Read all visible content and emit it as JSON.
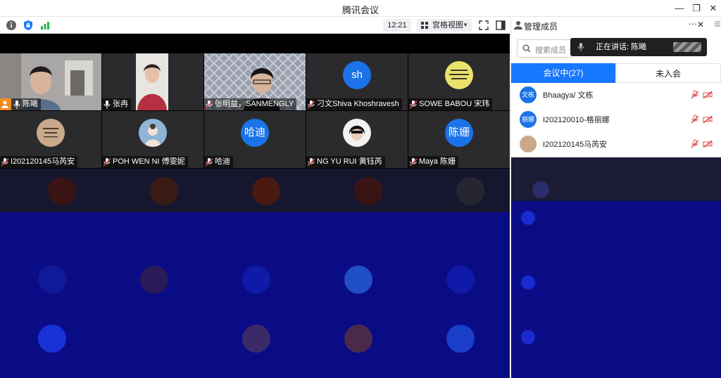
{
  "window": {
    "title": "腾讯会议",
    "minimize_icon": "minimize-icon",
    "restore_icon": "restore-icon",
    "close_icon": "close-icon"
  },
  "toolbar": {
    "info_icon": "info-icon",
    "shield_icon": "shield-icon",
    "signal_icon": "signal-icon",
    "time": "12:21",
    "view_mode": "宫格视图",
    "fullscreen_icon": "fullscreen-icon",
    "sidebar_icon": "sidebar-toggle-icon"
  },
  "tiles": [
    {
      "name": "陈曦",
      "type": "video",
      "active": true,
      "host": true
    },
    {
      "name": "张冉",
      "type": "video"
    },
    {
      "name": "张明益，SANMENGLY",
      "type": "video"
    },
    {
      "name": "刁文Shiva Khoshravesh",
      "type": "avatar",
      "avatar_text": "sh",
      "color": "#1a73e8"
    },
    {
      "name": "SOWE BABOU 宋玮",
      "type": "photo-avatar",
      "color": "#e9e26b"
    },
    {
      "name": "I202120145马芮安",
      "type": "photo-avatar",
      "color": "#caa88b"
    },
    {
      "name": "POH WEN NI 傅雯妮",
      "type": "photo-avatar",
      "color": "#8fb4d6"
    },
    {
      "name": "哈迪",
      "type": "avatar",
      "avatar_text": "哈迪",
      "color": "#1a73e8"
    },
    {
      "name": "NG YU RUI 黄钰芮",
      "type": "photo-avatar",
      "color": "#444444"
    },
    {
      "name": "Maya 陈姗",
      "type": "avatar",
      "avatar_text": "陈姗",
      "color": "#1a73e8"
    }
  ],
  "panel": {
    "title": "管理成员",
    "more_icon": "more-icon",
    "close_icon": "close-icon",
    "search_placeholder": "搜索成员",
    "speaking_label": "正在讲话: 陈曦",
    "tab_in_meeting": "会议中(27)",
    "tab_not_joined": "未入会",
    "members": [
      {
        "avatar_text": "文栋",
        "name": "Bhaagya/ 文栋",
        "color": "#1a73e8"
      },
      {
        "avatar_text": "丽娜",
        "name": "I202120010-格丽娜",
        "color": "#1a73e8"
      },
      {
        "avatar_text": "",
        "name": "I202120145马芮安",
        "color": "#caa88b"
      }
    ]
  },
  "colors": {
    "accent": "#1677ff",
    "active_outline": "#37c25b",
    "host": "#f08c1c",
    "muted_red": "#e0484d"
  }
}
